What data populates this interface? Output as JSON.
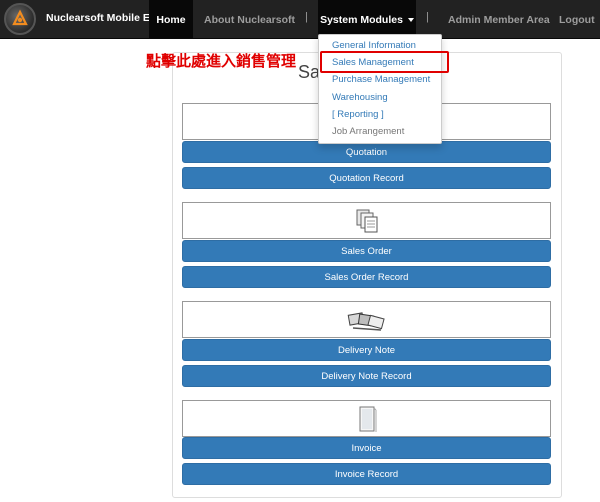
{
  "navbar": {
    "brand": "Nuclearsoft Mobile ERP",
    "home": "Home",
    "about": "About Nuclearsoft",
    "separator": "|",
    "modules": "System Modules",
    "admin": "Admin Member Area",
    "logout": "Logout"
  },
  "dropdown": {
    "items": [
      "General Information",
      "Sales Management",
      "Purchase Management",
      "Warehousing",
      "[ Reporting ]",
      "Job Arrangement"
    ]
  },
  "annotation": "點擊此處進入銷售管理",
  "panel": {
    "title": "Sales",
    "buttons": [
      "Quotation",
      "Quotation Record",
      "Sales Order",
      "Sales Order Record",
      "Delivery Note",
      "Delivery Note Record",
      "Invoice",
      "Invoice Record"
    ]
  },
  "colors": {
    "navbar": "#222222",
    "button": "#337ab7",
    "annotation": "#e00000"
  }
}
